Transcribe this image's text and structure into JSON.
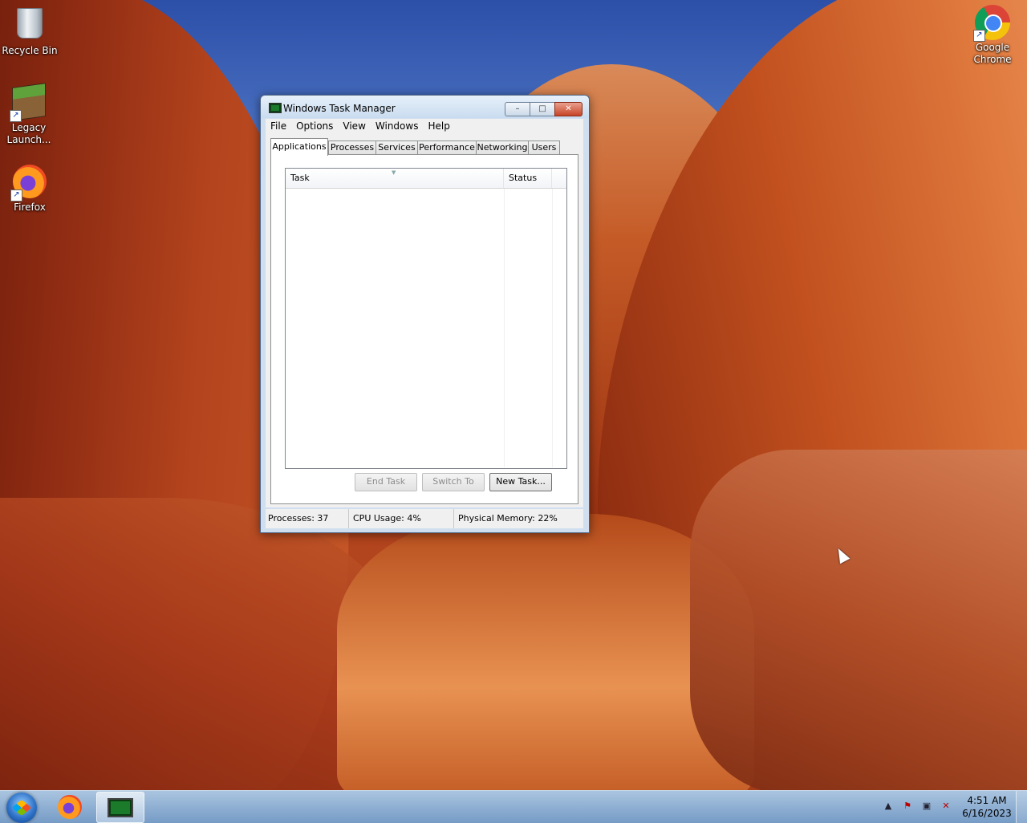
{
  "desktop": {
    "icons": [
      {
        "label": "Recycle Bin",
        "icon": "recycle-bin-icon"
      },
      {
        "label": "Legacy Launch...",
        "icon": "minecraft-launcher-icon"
      },
      {
        "label": "Firefox",
        "icon": "firefox-icon"
      },
      {
        "label": "Google Chrome",
        "icon": "chrome-icon"
      }
    ]
  },
  "window": {
    "title": "Windows Task Manager",
    "caption_buttons": {
      "minimize": "–",
      "maximize": "□",
      "close": "✕"
    },
    "menu": [
      "File",
      "Options",
      "View",
      "Windows",
      "Help"
    ],
    "tabs": [
      "Applications",
      "Processes",
      "Services",
      "Performance",
      "Networking",
      "Users"
    ],
    "active_tab": "Applications",
    "columns": [
      "Task",
      "Status"
    ],
    "rows": [],
    "buttons": {
      "end_task": "End Task",
      "switch_to": "Switch To",
      "new_task": "New Task..."
    },
    "status": {
      "processes": "Processes: 37",
      "cpu": "CPU Usage: 4%",
      "memory": "Physical Memory: 22%"
    }
  },
  "taskbar": {
    "apps": [
      {
        "name": "Firefox",
        "icon": "firefox-icon"
      },
      {
        "name": "Windows Task Manager",
        "icon": "task-manager-icon",
        "active": true
      }
    ],
    "tray": {
      "show_hidden": "▲",
      "icons": [
        "action-center-flag-icon",
        "network-icon",
        "volume-muted-icon"
      ]
    },
    "clock": {
      "time": "4:51 AM",
      "date": "6/16/2023"
    }
  }
}
